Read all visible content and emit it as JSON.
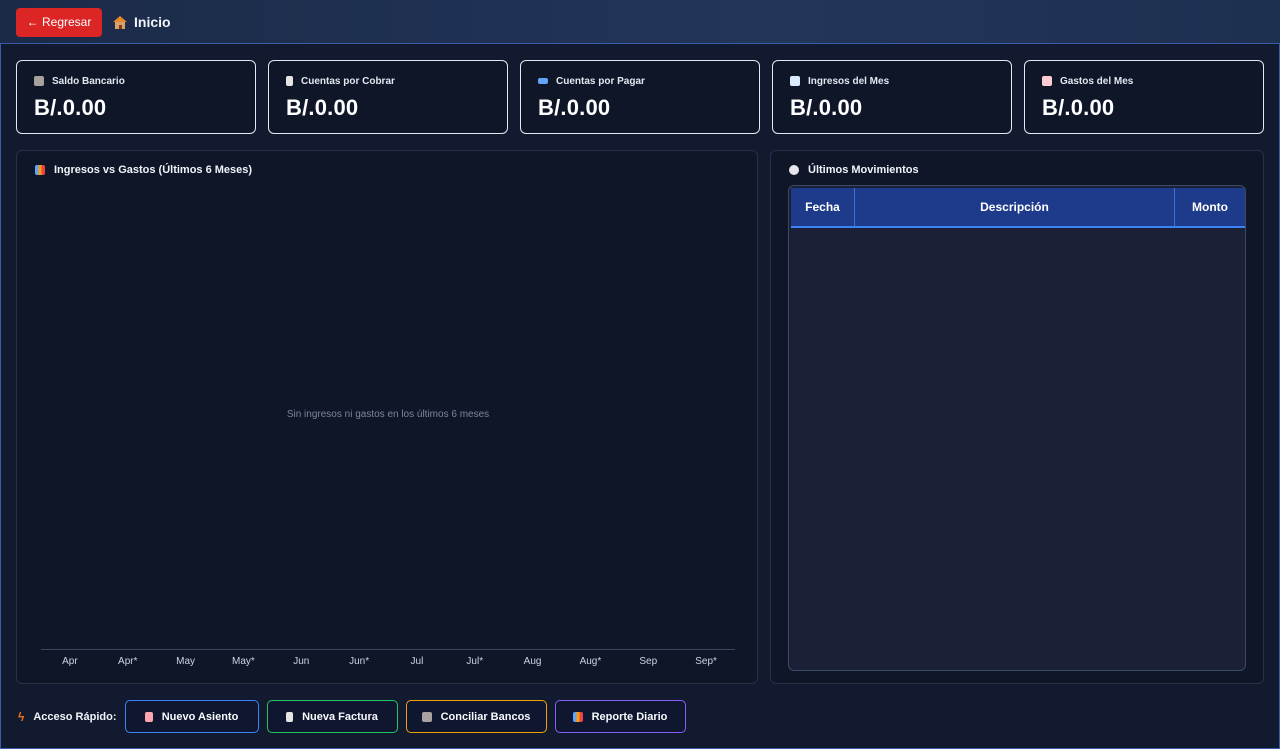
{
  "topbar": {
    "back_label": "← Regresar",
    "home_label": "Inicio"
  },
  "cards": [
    {
      "title": "Saldo Bancario",
      "value": "B/.0.00",
      "color": "#3b82f6",
      "icon": "bank-icon"
    },
    {
      "title": "Cuentas por Cobrar",
      "value": "B/.0.00",
      "color": "#f59e0b",
      "icon": "receipt-icon"
    },
    {
      "title": "Cuentas por Pagar",
      "value": "B/.0.00",
      "color": "#ef4444",
      "icon": "card-icon"
    },
    {
      "title": "Ingresos del Mes",
      "value": "B/.0.00",
      "color": "#22c55e",
      "icon": "chart-up-icon"
    },
    {
      "title": "Gastos del Mes",
      "value": "B/.0.00",
      "color": "#f43f5e",
      "icon": "chart-down-icon"
    }
  ],
  "chart_panel": {
    "title": "Ingresos vs Gastos (Últimos 6 Meses)",
    "empty_message": "Sin ingresos ni gastos en los últimos 6 meses"
  },
  "chart_data": {
    "type": "bar",
    "categories": [
      "Apr",
      "Apr*",
      "May",
      "May*",
      "Jun",
      "Jun*",
      "Jul",
      "Jul*",
      "Aug",
      "Aug*",
      "Sep",
      "Sep*"
    ],
    "series": []
  },
  "movements": {
    "title": "Últimos Movimientos",
    "columns": [
      "Fecha",
      "Descripción",
      "Monto"
    ],
    "rows": []
  },
  "quick_access": {
    "label": "Acceso Rápido:",
    "buttons": [
      {
        "label": "Nuevo Asiento",
        "color": "#3b82f6",
        "icon": "document-icon"
      },
      {
        "label": "Nueva Factura",
        "color": "#22c55e",
        "icon": "invoice-icon"
      },
      {
        "label": "Conciliar Bancos",
        "color": "#f59e0b",
        "icon": "bank-icon"
      },
      {
        "label": "Reporte Diario",
        "color": "#8b5cf6",
        "icon": "report-icon"
      }
    ]
  }
}
